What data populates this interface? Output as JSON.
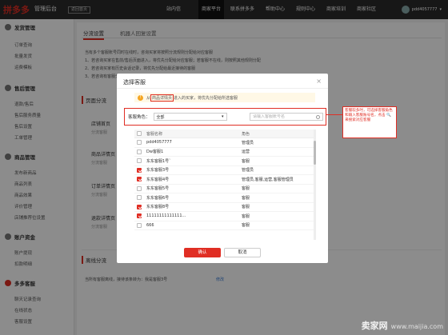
{
  "header": {
    "logo": "拼多多",
    "logo_sub": "管理后台",
    "back_home": "返回首页",
    "nav": [
      "站内信",
      "商家平台",
      "联系拼多多",
      "帮助中心",
      "规则中心",
      "商家培训",
      "商家社区"
    ],
    "user": "pdd4057777"
  },
  "sidebar": {
    "sections": [
      {
        "title": "发货管理",
        "items": [
          "订单查询",
          "批量发货",
          "运费模板"
        ]
      },
      {
        "title": "售后管理",
        "items": [
          "退款/售后",
          "售后服务质量",
          "售后设置",
          "工单管理"
        ]
      },
      {
        "title": "商品管理",
        "items": [
          "发布新商品",
          "商品列表",
          "商品效果",
          "评价管理",
          "店铺推荐位设置"
        ]
      },
      {
        "title": "账户资金",
        "items": [
          "账户提现",
          "扣款明细"
        ]
      },
      {
        "title": "多多客服",
        "items": [
          "聊天记录查询",
          "在线状态",
          "客服设置"
        ]
      }
    ]
  },
  "main": {
    "tabs": [
      "分流设置",
      "机器人回复设置"
    ],
    "notices": [
      "当有多个客服账号同时在线时，咨询买家将按照分流规则分配给对应客服",
      "1、若咨询买家在售前/售后页面进入，将优先分配给对应客服；若客服不在线，则按照其他规则分配",
      "2、若咨询买家有历史会话记录，将优先分配给最近接待的客服",
      "3、若咨询有客服分配规则，其余客服按平均分配"
    ],
    "panel_title": "页面分流",
    "groups": [
      {
        "label": "店铺首页",
        "sub": "分流客服"
      },
      {
        "label": "商品详情页",
        "sub": "分流客服"
      },
      {
        "label": "订单详情页",
        "sub": "分流客服"
      },
      {
        "label": "退款详情页",
        "sub": "分流客服"
      }
    ],
    "offline_title": "离线分流",
    "offline_text": "当所有客服离线，接待该条转为：我是客服3号",
    "offline_link": "修改"
  },
  "modal": {
    "title": "选择客服",
    "close": "×",
    "tip_pre": "从",
    "tip_highlight": "商品详情页",
    "tip_post": "进入的买家，将优先分配给所选客服",
    "role_label": "客服角色：",
    "role_value": "全部",
    "search_placeholder": "请输入客服账号名",
    "columns": [
      "客服名称",
      "角色"
    ],
    "rows": [
      {
        "name": "pdd4057777",
        "role": "管理员",
        "checked": false
      },
      {
        "name": "Dw客服1",
        "role": "运营",
        "checked": false
      },
      {
        "name": "东东客服1号`",
        "role": "客服",
        "checked": false
      },
      {
        "name": "东东客服3号",
        "role": "管理员",
        "checked": true
      },
      {
        "name": "东东客服4号",
        "role": "管理员,客服,运营,客服管理员",
        "checked": true
      },
      {
        "name": "东东客服5号",
        "role": "客服",
        "checked": false
      },
      {
        "name": "东东客服6号",
        "role": "客服",
        "checked": false
      },
      {
        "name": "东东客服8号",
        "role": "客服",
        "checked": true
      },
      {
        "name": "11111111111111...",
        "role": "客服",
        "checked": true
      },
      {
        "name": "666",
        "role": "客服",
        "checked": false
      }
    ],
    "ok": "确认",
    "cancel": "取消"
  },
  "annotation": "客服较多时，可选择客服角色和输入客服账号名，点击 🔍 来搜索对应客服",
  "watermark": {
    "main": "卖家网",
    "url": "www.maijia.com"
  },
  "colors": {
    "brand": "#e02e24",
    "topbar": "#2b2b2b"
  }
}
